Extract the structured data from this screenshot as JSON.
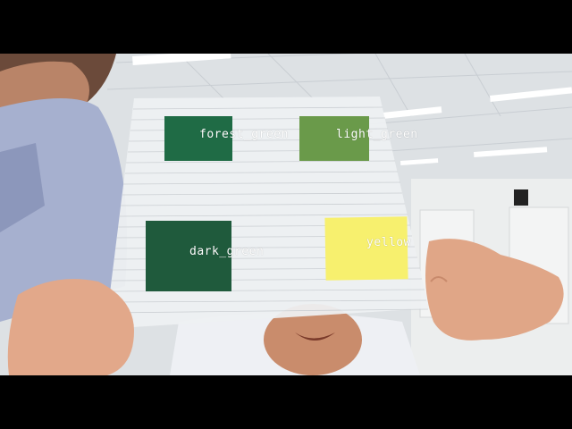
{
  "detections": [
    {
      "label": "forest_green",
      "color": "#1f6b45"
    },
    {
      "label": "light_green",
      "color": "#6a9a4a"
    },
    {
      "label": "dark_green",
      "color": "#1f5a3c"
    },
    {
      "label": "yellow",
      "color": "#f7f06e"
    }
  ],
  "colors": {
    "letterbox": "#000000",
    "ceiling": "#e4e7e9",
    "sheet": "#eef0f2",
    "shirt": "#9fa9c8",
    "skin": "#e2a88a",
    "label_text": "#ffffff"
  }
}
